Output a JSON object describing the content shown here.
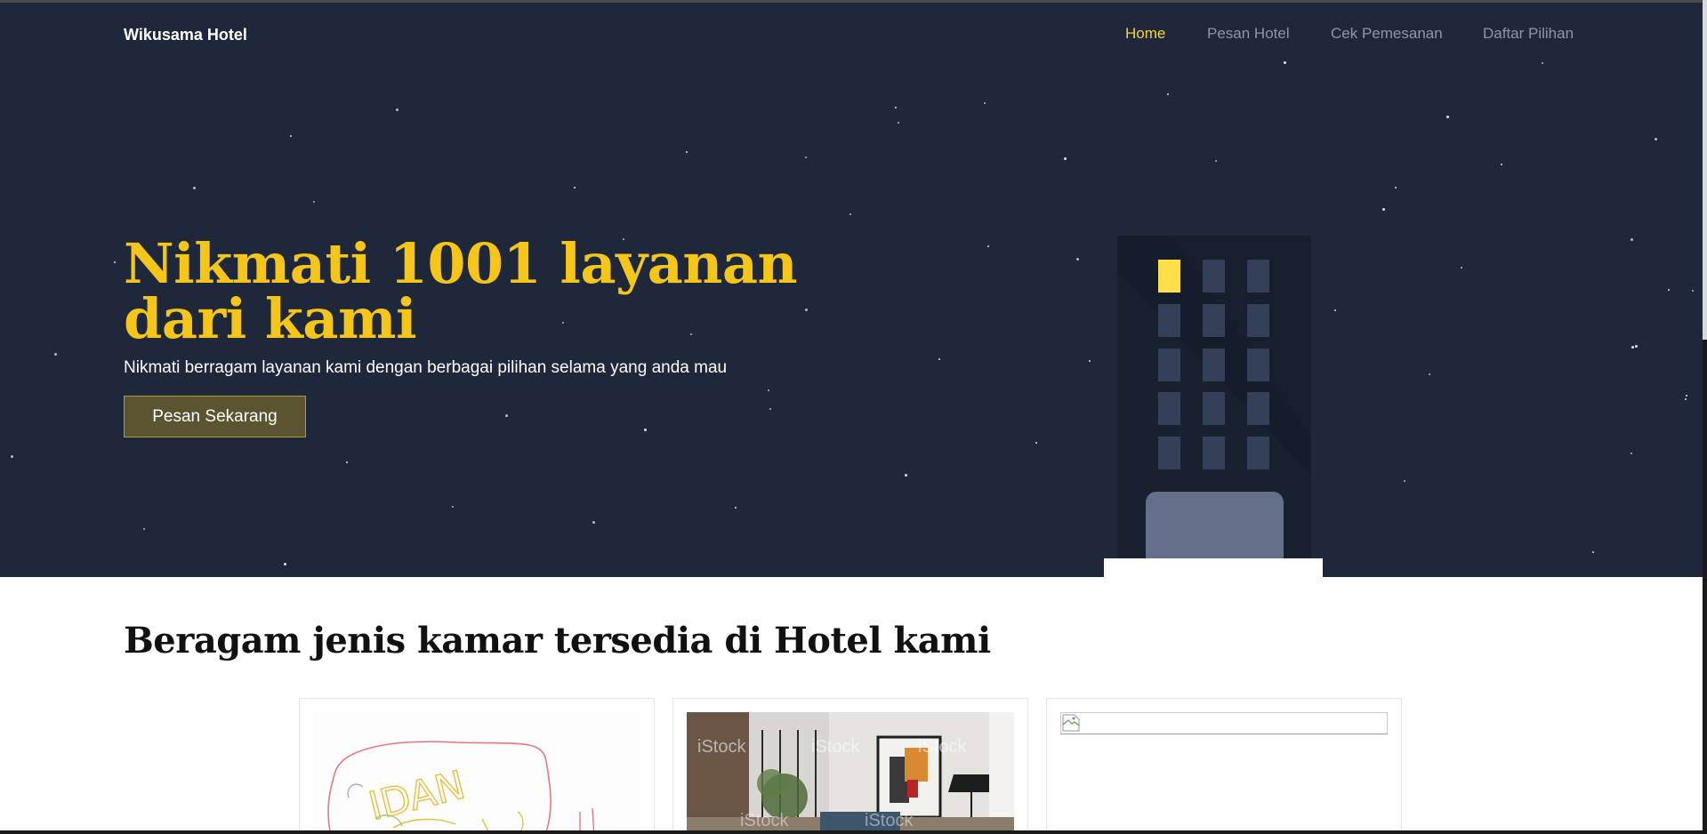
{
  "navbar": {
    "brand": "Wikusama Hotel",
    "links": [
      {
        "label": "Home",
        "active": true
      },
      {
        "label": "Pesan Hotel",
        "active": false
      },
      {
        "label": "Cek Pemesanan",
        "active": false
      },
      {
        "label": "Daftar Pilihan",
        "active": false
      }
    ]
  },
  "hero": {
    "title": "Nikmati 1001 layanan dari kami",
    "subtitle": "Nikmati berragam layanan kami dengan berbagai pilihan selama yang anda mau",
    "cta_label": "Pesan Sekarang",
    "illustration": "hotel-building-night-illustration"
  },
  "rooms_section": {
    "title": "Beragam jenis kamar tersedia di Hotel kami",
    "cards": [
      {
        "image": "handwritten-sketch-image",
        "sketch_text": "IDAN"
      },
      {
        "image": "room-interior-photo",
        "watermark": "iStock"
      },
      {
        "image": "broken-image-icon"
      }
    ]
  },
  "colors": {
    "hero_bg": "#1f283b",
    "accent": "#f5c518",
    "nav_active": "#f7d33e",
    "nav_inactive": "#8d96a6",
    "button_bg": "#5b5431",
    "lit_window": "#fde047"
  }
}
